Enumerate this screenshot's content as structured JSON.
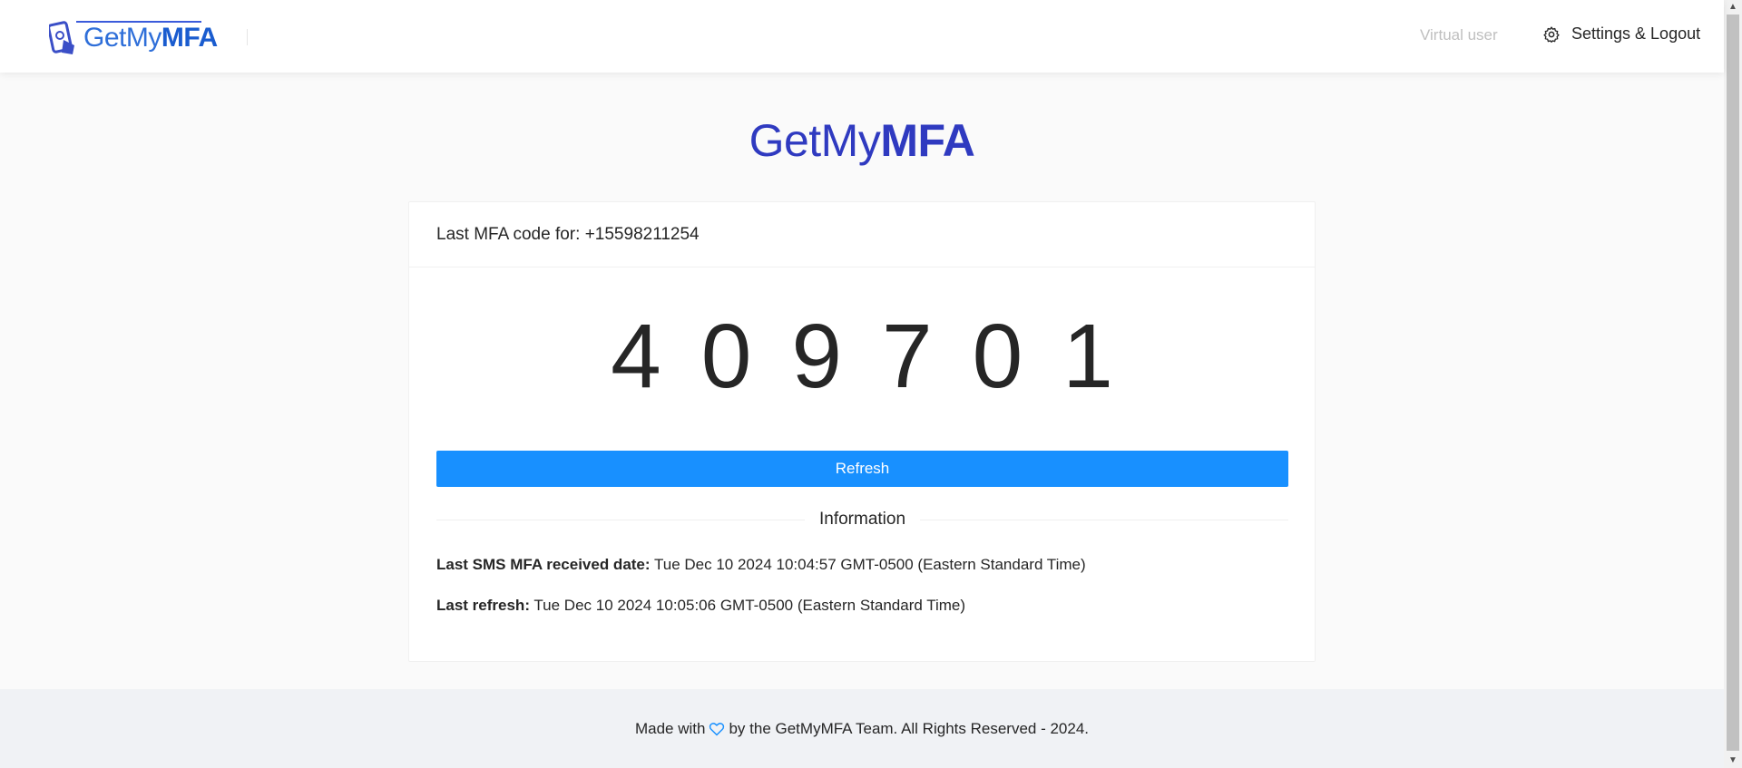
{
  "header": {
    "logo": {
      "get": "Get",
      "my": "My",
      "mfa": "MFA"
    },
    "virtual_user": "Virtual user",
    "settings_label": "Settings & Logout",
    "settings_icon": "gear-icon"
  },
  "brand": {
    "get_my": "GetMy",
    "mfa": "MFA"
  },
  "card": {
    "title_prefix": "Last MFA code for:",
    "phone": "+15598211254",
    "code": "409701",
    "refresh_label": "Refresh",
    "info_title": "Information",
    "last_sms_label": "Last SMS MFA received date:",
    "last_sms_value": "Tue Dec 10 2024 10:04:57 GMT-0500 (Eastern Standard Time)",
    "last_refresh_label": "Last refresh:",
    "last_refresh_value": "Tue Dec 10 2024 10:05:06 GMT-0500 (Eastern Standard Time)"
  },
  "footer": {
    "made_with": "Made with",
    "rest": "by the GetMyMFA Team. All Rights Reserved - 2024.",
    "heart_icon": "heart-icon",
    "heart_color": "#1890ff"
  },
  "colors": {
    "accent": "#1890ff",
    "brand": "#2f3ac0"
  }
}
